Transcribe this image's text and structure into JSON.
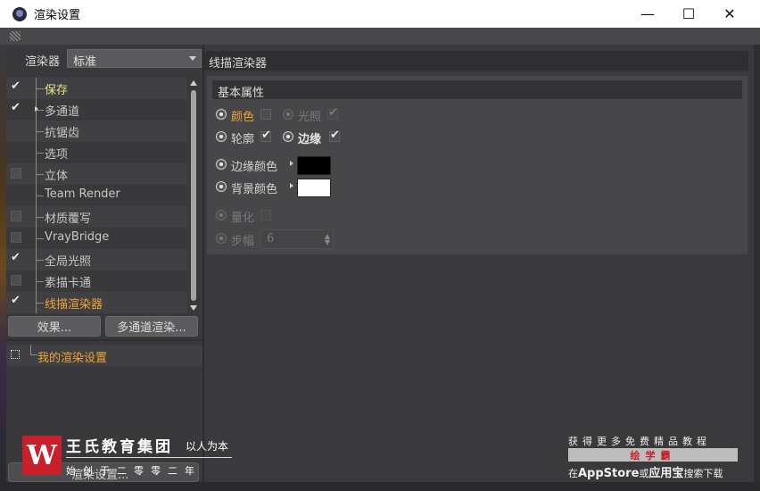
{
  "window": {
    "title": "渲染设置",
    "minimize": "—",
    "maximize": "☐",
    "close": "✕"
  },
  "left": {
    "renderer_label": "渲染器",
    "renderer_value": "标准",
    "items": [
      {
        "label": "保存",
        "checked": true,
        "style": "yellow"
      },
      {
        "label": "多通道",
        "checked": true,
        "style": "normal",
        "expandable": true
      },
      {
        "label": "抗锯齿",
        "checked": null,
        "style": "normal"
      },
      {
        "label": "选项",
        "checked": null,
        "style": "normal"
      },
      {
        "label": "立体",
        "checked": false,
        "style": "normal"
      },
      {
        "label": "Team Render",
        "checked": null,
        "style": "normal"
      },
      {
        "label": "材质覆写",
        "checked": false,
        "style": "normal"
      },
      {
        "label": "VrayBridge",
        "checked": false,
        "style": "normal"
      },
      {
        "label": "全局光照",
        "checked": true,
        "style": "normal"
      },
      {
        "label": "素描卡通",
        "checked": false,
        "style": "normal"
      },
      {
        "label": "线描渲染器",
        "checked": true,
        "style": "orange"
      }
    ],
    "effects_button": "效果...",
    "multipass_button": "多通道渲染...",
    "my_settings": "我的渲染设置",
    "render_settings_button": "渲染设置..."
  },
  "right": {
    "header": "线描渲染器",
    "group_title": "基本属性",
    "color_label": "颜色",
    "color_checked": false,
    "lighting_label": "光照",
    "lighting_checked": true,
    "outline_label": "轮廓",
    "outline_checked": true,
    "edge_label": "边缘",
    "edge_checked": true,
    "edge_color_label": "边缘颜色",
    "edge_color": "#000000",
    "bg_color_label": "背景颜色",
    "bg_color": "#ffffff",
    "quantize_label": "量化",
    "quantize_checked": false,
    "step_label": "步幅",
    "step_value": "6"
  },
  "watermark": {
    "logo": "W",
    "org_name": "王氏教育集团",
    "slogan": "以人为本",
    "date": "始创于二零零二年",
    "ad_top": "获得更多免费精品教程",
    "ad_brand": "绘学霸",
    "ad_bottom_prefix": "在",
    "ad_bottom_store": "AppStore",
    "ad_bottom_mid": "或",
    "ad_bottom_app": "应用宝",
    "ad_bottom_suffix": "搜索下载"
  },
  "colors": {
    "accent_orange": "#f0a436",
    "accent_yellow": "#efe08a",
    "brand_red": "#c8202a"
  }
}
